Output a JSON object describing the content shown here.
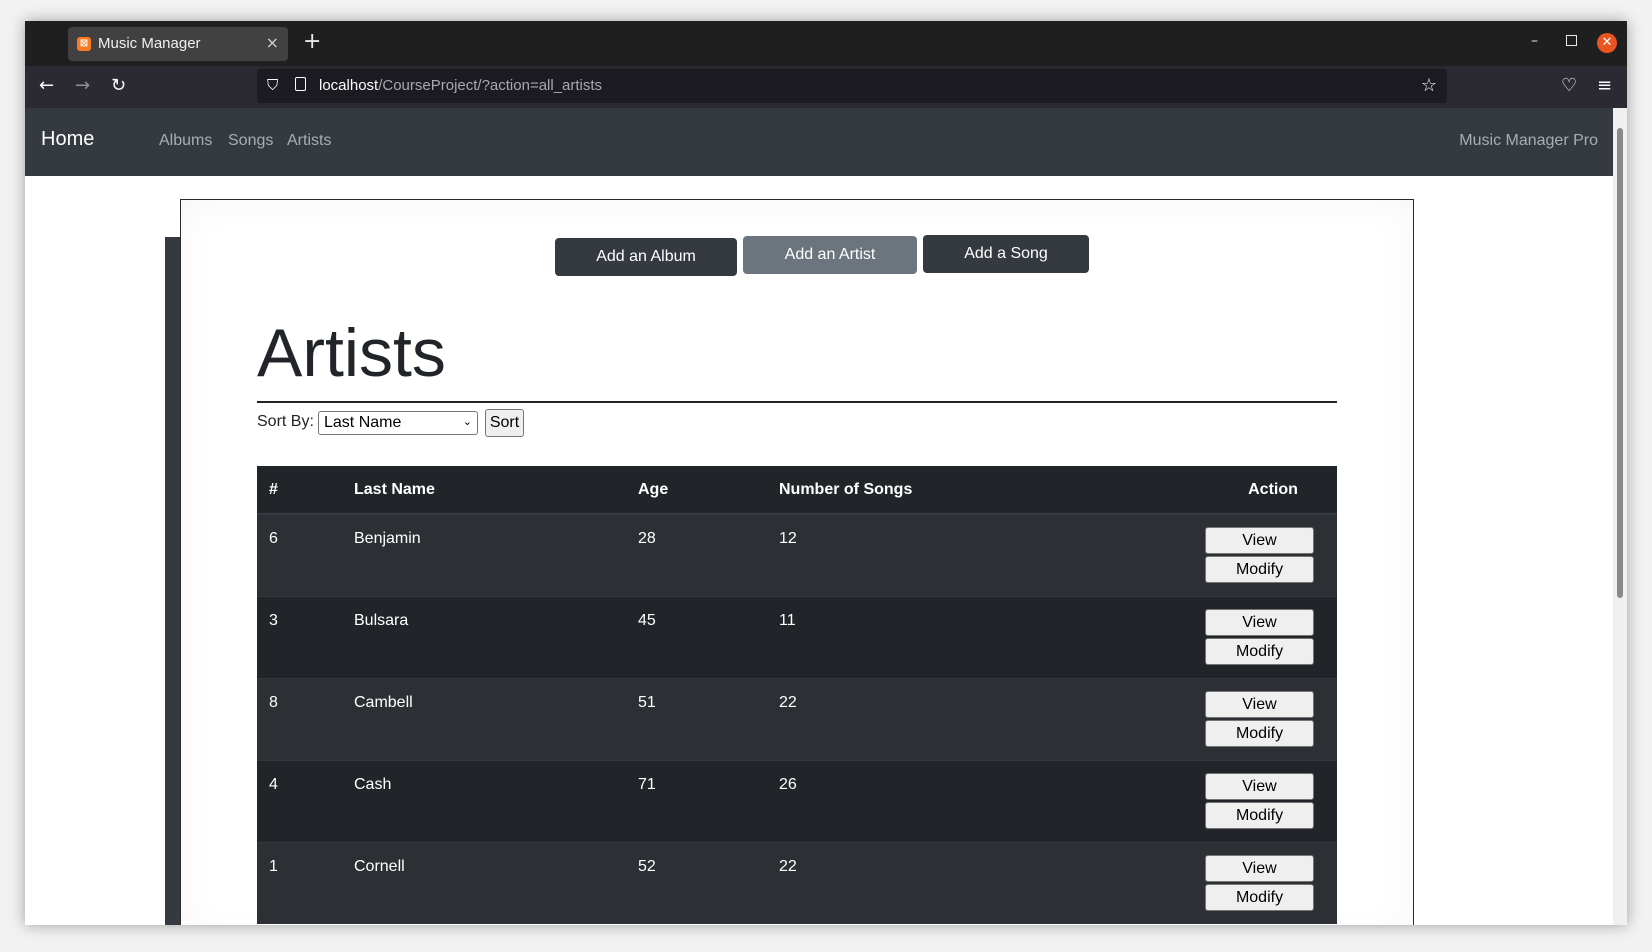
{
  "browser": {
    "tab_title": "Music Manager",
    "tab_close": "×",
    "new_tab": "+",
    "url_host": "localhost",
    "url_path": "/CourseProject/?action=all_artists",
    "icons": [
      "back-icon",
      "forward-icon",
      "reload-icon",
      "shield-icon",
      "page-icon",
      "star-icon",
      "pocket-icon",
      "menu-icon"
    ]
  },
  "navbar": {
    "brand": "Home",
    "links": [
      "Albums",
      "Songs",
      "Artists"
    ],
    "right_text": "Music Manager Pro"
  },
  "actions": {
    "add_album": "Add an Album",
    "add_artist": "Add an Artist",
    "add_song": "Add a Song"
  },
  "page": {
    "title": "Artists",
    "sort_label": "Sort By:",
    "sort_selected": "Last Name",
    "sort_button": "Sort"
  },
  "table": {
    "headers": [
      "#",
      "Last Name",
      "Age",
      "Number of Songs",
      "Action"
    ],
    "rows": [
      {
        "id": "6",
        "last_name": "Benjamin",
        "age": "28",
        "songs": "12"
      },
      {
        "id": "3",
        "last_name": "Bulsara",
        "age": "45",
        "songs": "11"
      },
      {
        "id": "8",
        "last_name": "Cambell",
        "age": "51",
        "songs": "22"
      },
      {
        "id": "4",
        "last_name": "Cash",
        "age": "71",
        "songs": "26"
      },
      {
        "id": "1",
        "last_name": "Cornell",
        "age": "52",
        "songs": "22"
      }
    ],
    "view_label": "View",
    "modify_label": "Modify"
  },
  "colors": {
    "navbar_bg": "#343a40",
    "table_bg": "#212529",
    "secondary_btn": "#6c757d"
  }
}
